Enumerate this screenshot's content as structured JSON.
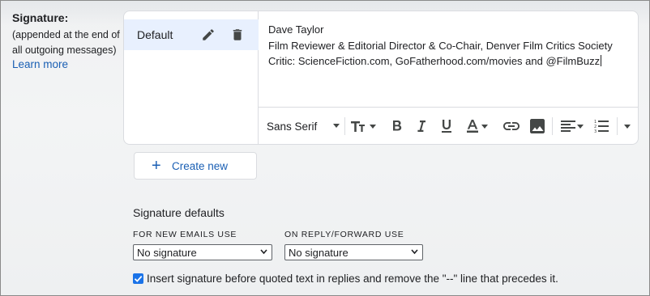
{
  "signature_section": {
    "heading": "Signature:",
    "description": "(appended at the end of all outgoing messages)",
    "learn_more": "Learn more"
  },
  "signatures": [
    {
      "name": "Default",
      "selected": true
    }
  ],
  "editor": {
    "lines": [
      "Dave Taylor",
      "Film Reviewer & Editorial Director & Co-Chair, Denver Film Critics Society",
      "Critic: ScienceFiction.com, GoFatherhood.com/movies and @FilmBuzz"
    ]
  },
  "toolbar": {
    "font_family": "Sans Serif",
    "icons": [
      "font-size-icon",
      "bold-icon",
      "italic-icon",
      "underline-icon",
      "text-color-icon",
      "link-icon",
      "image-icon",
      "align-icon",
      "numbered-list-icon",
      "more-formatting-icon"
    ]
  },
  "create_new": {
    "label": "Create new"
  },
  "defaults": {
    "title": "Signature defaults",
    "new_emails_label": "FOR NEW EMAILS USE",
    "new_emails_value": "No signature",
    "reply_label": "ON REPLY/FORWARD USE",
    "reply_value": "No signature"
  },
  "insert_option": {
    "checked": true,
    "label": "Insert signature before quoted text in replies and remove the \"--\" line that precedes it."
  },
  "colors": {
    "accent": "#1a73e8",
    "link": "#1a5fb4",
    "selected_bg": "#e8f0fe",
    "border": "#dadce0"
  }
}
